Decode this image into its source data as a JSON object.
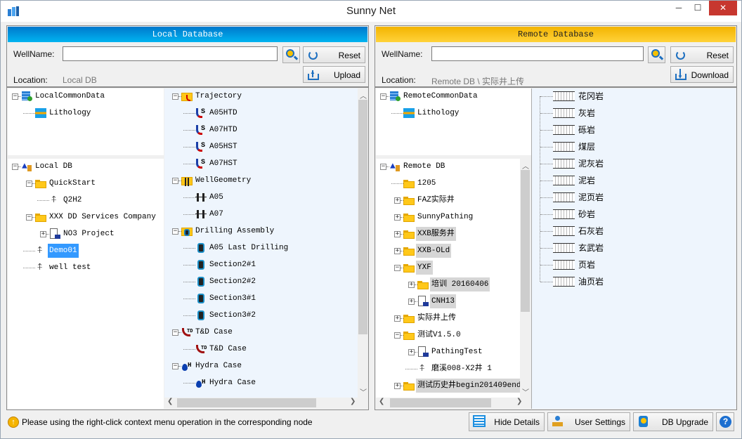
{
  "window": {
    "title": "Sunny Net",
    "controls": {
      "minimize": "─",
      "maximize": "☐",
      "close": "✕"
    }
  },
  "local": {
    "header": "Local Database",
    "wellname_label": "WellName:",
    "wellname_value": "",
    "reset_label": "Reset",
    "upload_label": "Upload",
    "location_label": "Location:",
    "location_value": "Local DB",
    "common_tree": [
      {
        "label": "LocalCommonData",
        "icon": "database",
        "depth": 0,
        "exp": "minus"
      },
      {
        "label": "Lithology",
        "icon": "lithology",
        "depth": 1
      }
    ],
    "db_tree": [
      {
        "label": "Local DB",
        "icon": "db-root",
        "depth": 0,
        "exp": "minus"
      },
      {
        "label": "QuickStart",
        "icon": "folder",
        "depth": 1,
        "exp": "minus"
      },
      {
        "label": "Q2H2",
        "icon": "well",
        "depth": 2
      },
      {
        "label": "XXX DD Services Company",
        "icon": "folder",
        "depth": 1,
        "exp": "minus"
      },
      {
        "label": "NO3 Project",
        "icon": "project",
        "depth": 2,
        "exp": "plus"
      },
      {
        "label": "Demo01",
        "icon": "well",
        "depth": 1,
        "selected": true
      },
      {
        "label": "well test",
        "icon": "well",
        "depth": 1
      }
    ],
    "detail_tree": [
      {
        "label": "Trajectory",
        "icon": "trajectory-folder",
        "depth": 0,
        "exp": "minus"
      },
      {
        "label": "A05HTD",
        "icon": "trajectory",
        "depth": 1
      },
      {
        "label": "A07HTD",
        "icon": "trajectory",
        "depth": 1
      },
      {
        "label": "A05HST",
        "icon": "trajectory",
        "depth": 1
      },
      {
        "label": "A07HST",
        "icon": "trajectory",
        "depth": 1
      },
      {
        "label": "WellGeometry",
        "icon": "geometry-folder",
        "depth": 0,
        "exp": "minus"
      },
      {
        "label": "A05",
        "icon": "geometry",
        "depth": 1
      },
      {
        "label": "A07",
        "icon": "geometry",
        "depth": 1
      },
      {
        "label": "Drilling Assembly",
        "icon": "assembly-folder",
        "depth": 0,
        "exp": "minus"
      },
      {
        "label": "A05 Last Drilling",
        "icon": "assembly",
        "depth": 1
      },
      {
        "label": "Section2#1",
        "icon": "assembly",
        "depth": 1
      },
      {
        "label": "Section2#2",
        "icon": "assembly",
        "depth": 1
      },
      {
        "label": "Section3#1",
        "icon": "assembly",
        "depth": 1
      },
      {
        "label": "Section3#2",
        "icon": "assembly",
        "depth": 1
      },
      {
        "label": "T&D Case",
        "icon": "td-case",
        "depth": 0,
        "exp": "minus"
      },
      {
        "label": "T&D Case",
        "icon": "td-case",
        "depth": 1
      },
      {
        "label": "Hydra Case",
        "icon": "hydra-case",
        "depth": 0,
        "exp": "minus"
      },
      {
        "label": "Hydra Case",
        "icon": "hydra-case",
        "depth": 1
      }
    ]
  },
  "remote": {
    "header": "Remote Database",
    "wellname_label": "WellName:",
    "wellname_value": "",
    "reset_label": "Reset",
    "download_label": "Download",
    "location_label": "Location:",
    "location_value": "Remote DB \\ 实际井上传",
    "common_tree": [
      {
        "label": "RemoteCommonData",
        "icon": "database",
        "depth": 0,
        "exp": "minus"
      },
      {
        "label": "Lithology",
        "icon": "lithology",
        "depth": 1
      }
    ],
    "db_tree": [
      {
        "label": "Remote DB",
        "icon": "db-root",
        "depth": 0,
        "exp": "minus"
      },
      {
        "label": "1205",
        "icon": "folder",
        "depth": 1
      },
      {
        "label": "FAZ实际井",
        "icon": "folder",
        "depth": 1,
        "exp": "plus"
      },
      {
        "label": "SunnyPathing",
        "icon": "folder",
        "depth": 1,
        "exp": "plus"
      },
      {
        "label": "XXB服务井",
        "icon": "folder",
        "depth": 1,
        "exp": "plus",
        "highlight": true
      },
      {
        "label": "XXB-OLd",
        "icon": "folder",
        "depth": 1,
        "exp": "plus",
        "highlight": true
      },
      {
        "label": "YXF",
        "icon": "folder",
        "depth": 1,
        "exp": "minus",
        "highlight": true
      },
      {
        "label": "培训 20160406",
        "icon": "folder",
        "depth": 2,
        "exp": "plus",
        "highlight": true
      },
      {
        "label": "CNH13",
        "icon": "project",
        "depth": 2,
        "exp": "plus",
        "highlight": true
      },
      {
        "label": "实际井上传",
        "icon": "folder",
        "depth": 1,
        "exp": "plus"
      },
      {
        "label": "测试V1.5.0",
        "icon": "folder",
        "depth": 1,
        "exp": "minus"
      },
      {
        "label": "PathingTest",
        "icon": "project",
        "depth": 2,
        "exp": "plus"
      },
      {
        "label": "磨溪008-X2井 1",
        "icon": "well",
        "depth": 2
      },
      {
        "label": "测试历史井begin201409end",
        "icon": "folder",
        "depth": 1,
        "exp": "plus",
        "highlight": true
      }
    ],
    "lithology": [
      "花冈岩",
      "灰岩",
      "砾岩",
      "煤层",
      "泥灰岩",
      "泥岩",
      "泥页岩",
      "砂岩",
      "石灰岩",
      "玄武岩",
      "页岩",
      "油页岩"
    ]
  },
  "status": {
    "message": "Please using the right-click context menu operation in the corresponding node",
    "hide_details": "Hide Details",
    "user_settings": "User Settings",
    "db_upgrade": "DB Upgrade",
    "help": "?"
  },
  "colors": {
    "local_header": "#0090dc",
    "remote_header": "#f7c41a",
    "selection": "#3399ff",
    "close": "#e81123",
    "detail_bg": "#eef5fd"
  }
}
